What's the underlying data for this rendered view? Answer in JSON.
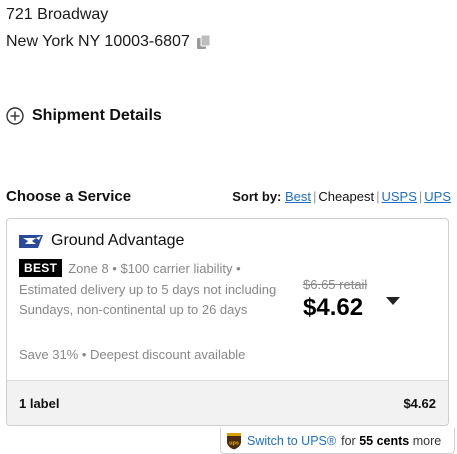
{
  "address": {
    "line1": "721 Broadway",
    "line2": "New York NY 10003-6807"
  },
  "shipment_details": {
    "label": "Shipment Details"
  },
  "choose_service": {
    "title": "Choose a Service",
    "sort_label": "Sort by:",
    "sort_options": [
      "Best",
      "Cheapest",
      "USPS",
      "UPS"
    ],
    "sort_active": "Cheapest"
  },
  "service_card": {
    "carrier_logo": "usps-eagle-icon",
    "name": "Ground Advantage",
    "badge": "BEST",
    "meta": "Zone 8 • $100 carrier liability •",
    "description": "Estimated delivery up to 5 days not including Sundays, non-continental up to 26 days",
    "savings": "Save 31% • Deepest discount available",
    "retail_price": "$6.65 retail",
    "price": "$4.62",
    "footer_label": "1 label",
    "footer_total": "$4.62"
  },
  "ups_offer": {
    "link_text": "Switch to UPS®",
    "for_text": "for",
    "amount": "55 cents",
    "more_text": "more"
  },
  "colors": {
    "link": "#1e6fc4",
    "usps_blue": "#2b4a9b",
    "ups_brown": "#4a2a12",
    "ups_gold": "#f5b400"
  }
}
